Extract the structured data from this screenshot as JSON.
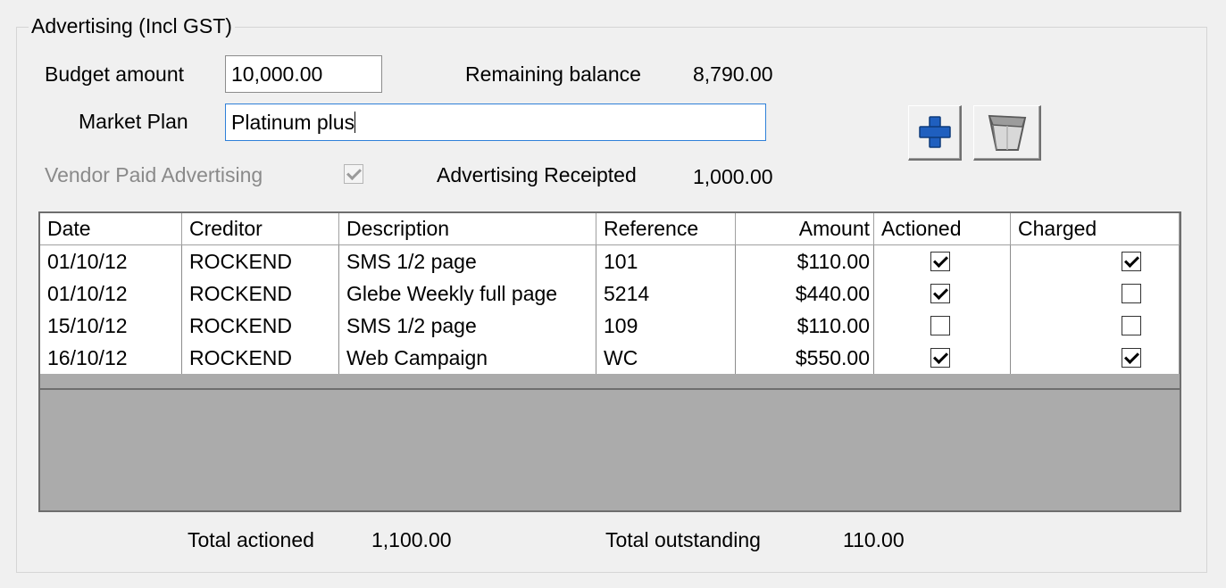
{
  "group": {
    "title": "Advertising (Incl GST)"
  },
  "form": {
    "budget_label": "Budget amount",
    "budget_value": "10,000.00",
    "remaining_label": "Remaining balance",
    "remaining_value": "8,790.00",
    "market_plan_label": "Market Plan",
    "market_plan_value": "Platinum plus",
    "vendor_paid_label": "Vendor Paid Advertising",
    "vendor_paid_checked": true,
    "receipted_label": "Advertising Receipted",
    "receipted_value": "1,000.00"
  },
  "toolbar": {
    "add_icon": "plus-icon",
    "delete_icon": "trash-bin-icon"
  },
  "grid": {
    "columns": [
      "Date",
      "Creditor",
      "Description",
      "Reference",
      "Amount",
      "Actioned",
      "Charged"
    ],
    "rows": [
      {
        "date": "01/10/12",
        "creditor": "ROCKEND",
        "description": "SMS 1/2 page",
        "reference": "101",
        "amount": "$110.00",
        "actioned": true,
        "charged": true
      },
      {
        "date": "01/10/12",
        "creditor": "ROCKEND",
        "description": "Glebe Weekly full page",
        "reference": "5214",
        "amount": "$440.00",
        "actioned": true,
        "charged": false
      },
      {
        "date": "15/10/12",
        "creditor": "ROCKEND",
        "description": "SMS 1/2 page",
        "reference": "109",
        "amount": "$110.00",
        "actioned": false,
        "charged": false
      },
      {
        "date": "16/10/12",
        "creditor": "ROCKEND",
        "description": "Web Campaign",
        "reference": "WC",
        "amount": "$550.00",
        "actioned": true,
        "charged": true
      }
    ]
  },
  "totals": {
    "actioned_label": "Total actioned",
    "actioned_value": "1,100.00",
    "outstanding_label": "Total outstanding",
    "outstanding_value": "110.00"
  },
  "colors": {
    "accent_blue": "#1f5fbf",
    "grid_empty": "#ababab",
    "focus_border": "#2f80d8"
  }
}
